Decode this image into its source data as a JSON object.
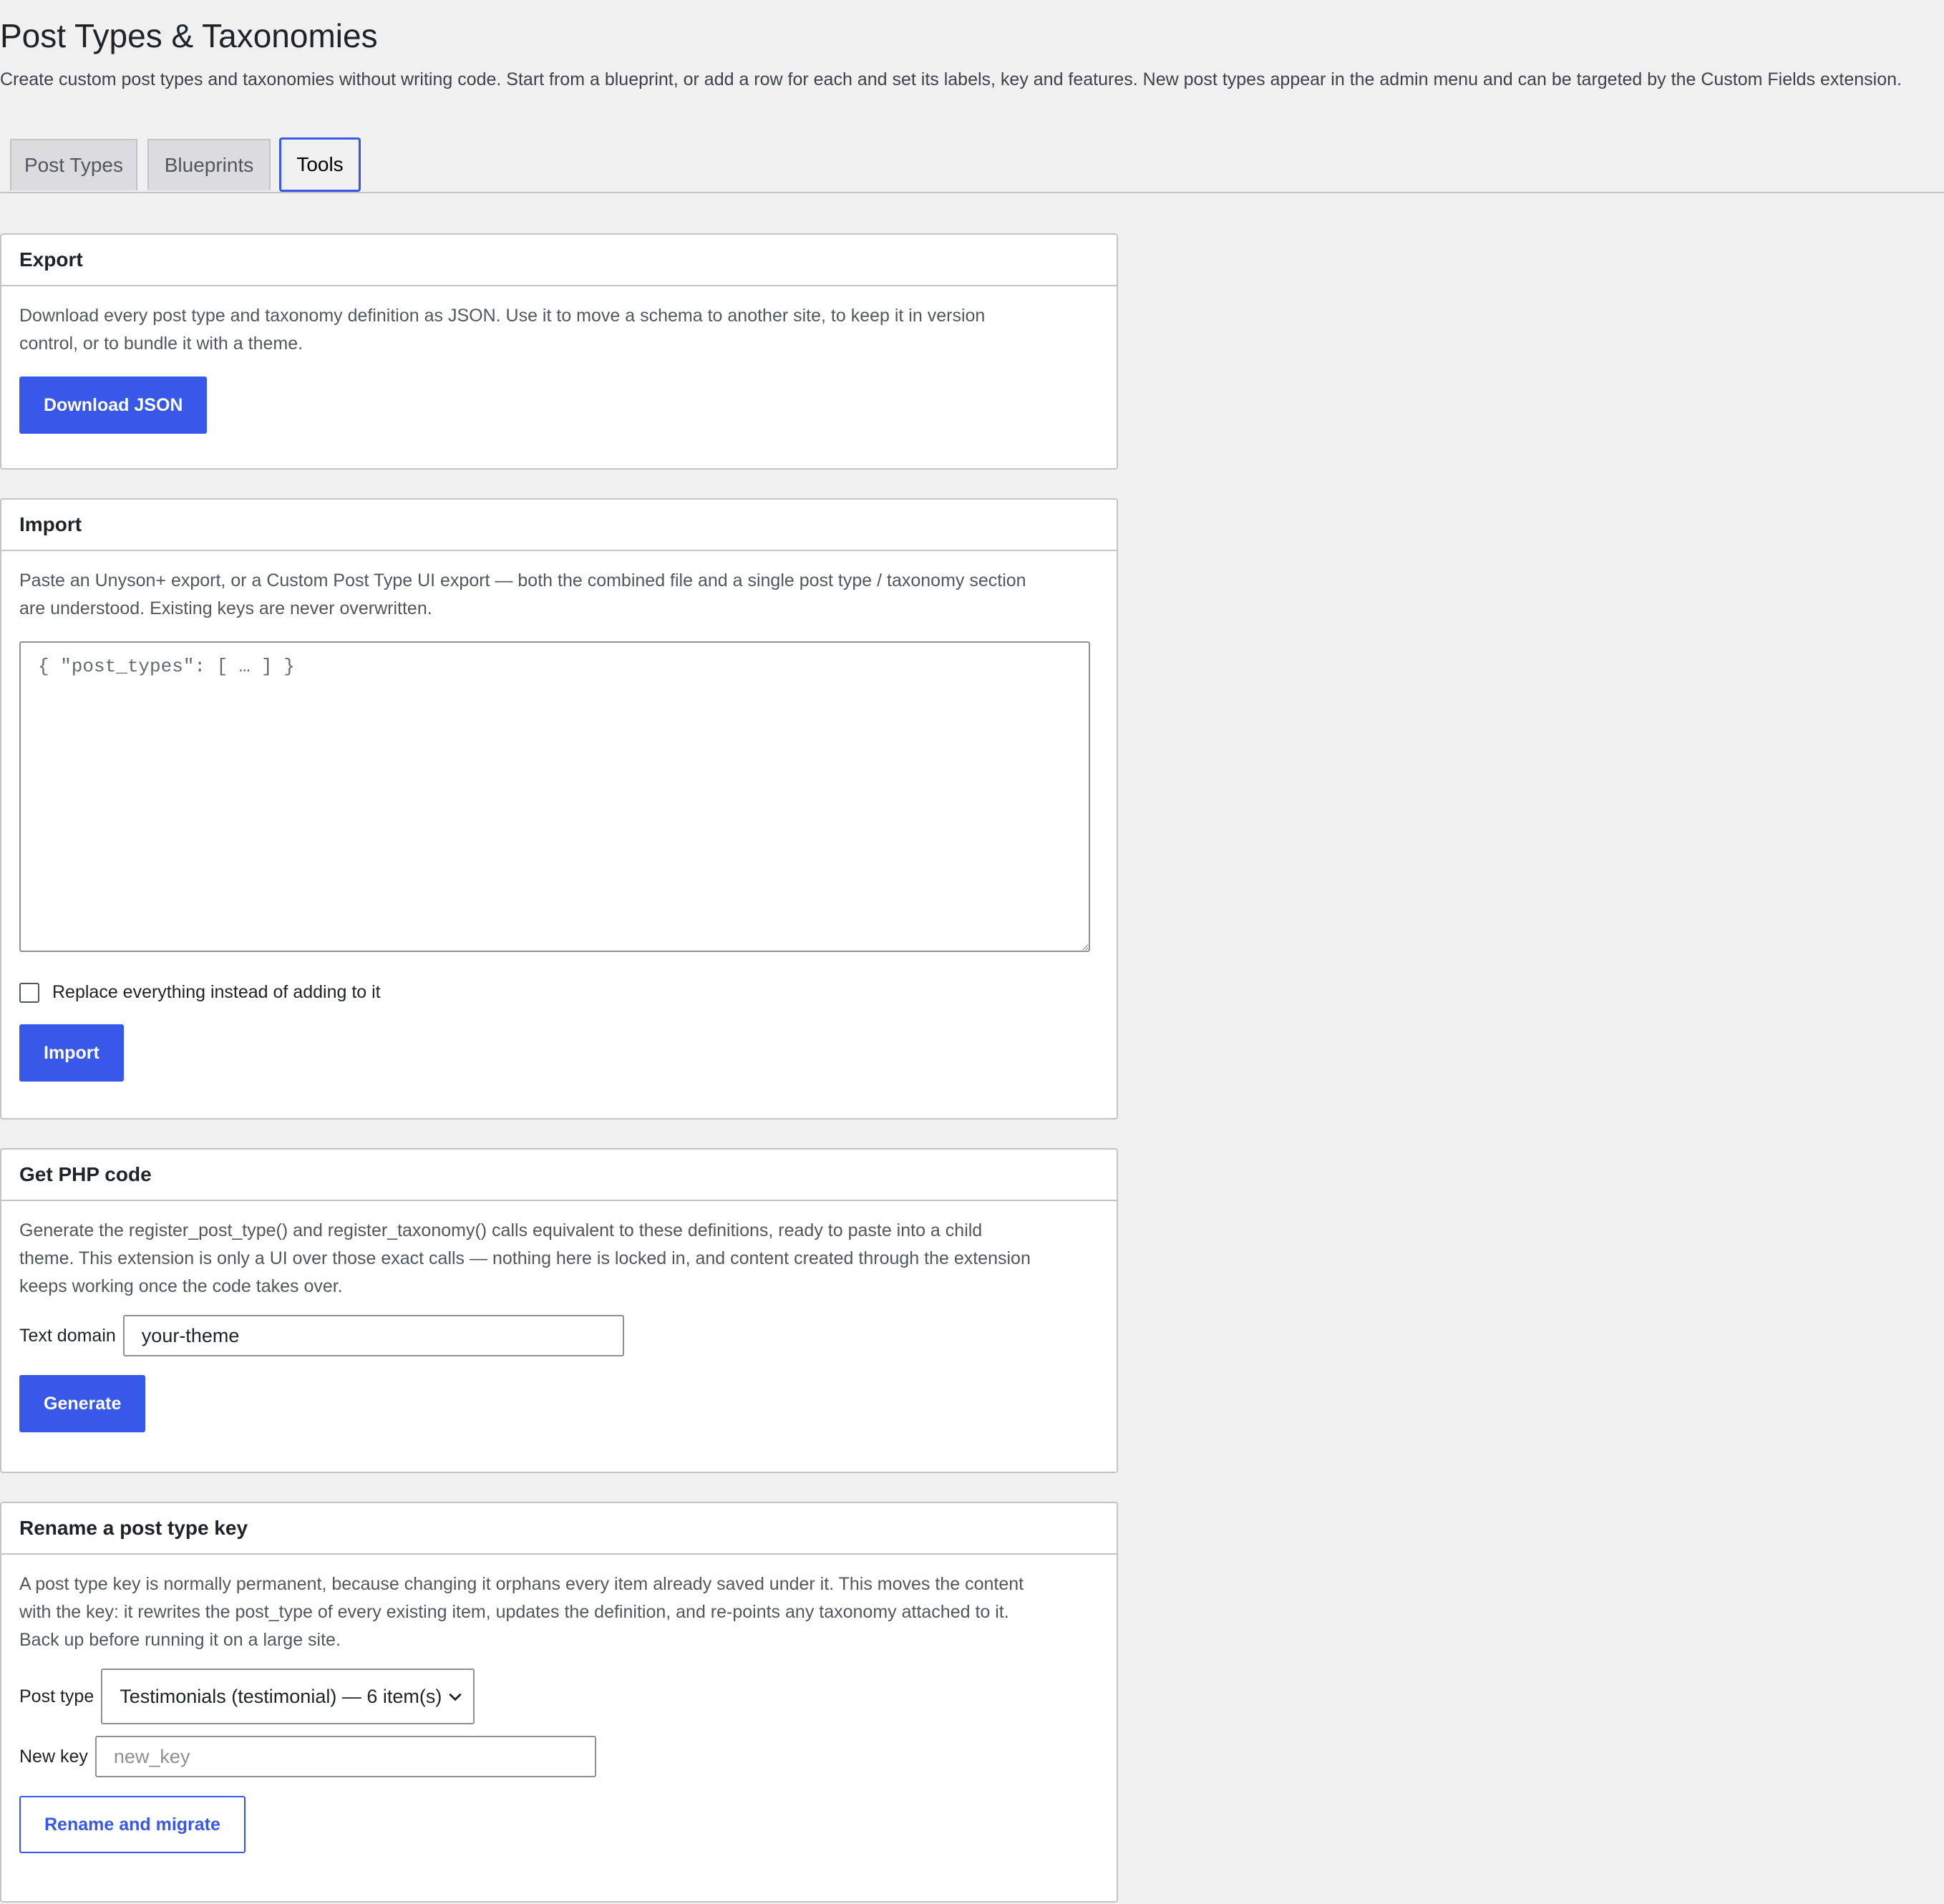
{
  "page": {
    "title": "Post Types & Taxonomies",
    "intro": "Create custom post types and taxonomies without writing code. Start from a blueprint, or add a row for each and set its labels, key and features. New post types appear in the admin menu and can be targeted by the Custom Fields extension."
  },
  "tabs": [
    {
      "label": "Post Types",
      "active": false
    },
    {
      "label": "Blueprints",
      "active": false
    },
    {
      "label": "Tools",
      "active": true
    }
  ],
  "export": {
    "title": "Export",
    "description": "Download every post type and taxonomy definition as JSON. Use it to move a schema to another site, to keep it in version control, or to bundle it with a theme.",
    "button": "Download JSON"
  },
  "import": {
    "title": "Import",
    "description": "Paste an Unyson+ export, or a Custom Post Type UI export — both the combined file and a single post type / taxonomy section are understood. Existing keys are never overwritten.",
    "placeholder": "{ \"post_types\": [ … ] }",
    "replace_label": "Replace everything instead of adding to it",
    "replace_checked": false,
    "button": "Import"
  },
  "php": {
    "title": "Get PHP code",
    "description": "Generate the register_post_type() and register_taxonomy() calls equivalent to these definitions, ready to paste into a child theme. This extension is only a UI over those exact calls — nothing here is locked in, and content created through the extension keeps working once the code takes over.",
    "text_domain_label": "Text domain",
    "text_domain_value": "your-theme",
    "button": "Generate"
  },
  "rename": {
    "title": "Rename a post type key",
    "description": "A post type key is normally permanent, because changing it orphans every item already saved under it. This moves the content with the key: it rewrites the post_type of every existing item, updates the definition, and re-points any taxonomy attached to it. Back up before running it on a large site.",
    "post_type_label": "Post type",
    "post_type_selected": "Testimonials (testimonial) — 6 item(s)",
    "new_key_label": "New key",
    "new_key_placeholder": "new_key",
    "button": "Rename and migrate"
  },
  "colors": {
    "accent": "#3858e9",
    "background": "#f0f0f1",
    "border": "#c3c4c7"
  }
}
